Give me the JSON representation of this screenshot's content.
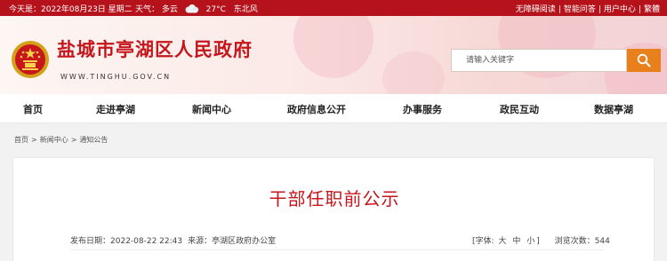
{
  "topbar": {
    "date": "今天是：2022年08月23日 星期二",
    "weather_label": "天气：",
    "condition": "多云",
    "temperature": "27°C",
    "wind": "东北风",
    "links": [
      "无障碍阅读",
      "智能问答",
      "用户中心",
      "繁體"
    ],
    "separator": "|"
  },
  "header": {
    "site_title": "盐城市亭湖区人民政府",
    "site_url": "WWW.TINGHU.GOV.CN",
    "search_placeholder": "请输入关键字"
  },
  "nav": {
    "items": [
      "首页",
      "走进亭湖",
      "新闻中心",
      "政府信息公开",
      "办事服务",
      "政民互动",
      "数据亭湖"
    ]
  },
  "breadcrumb": {
    "items": [
      "首页",
      "新闻中心",
      "通知公告"
    ],
    "separator": ">"
  },
  "article": {
    "title": "干部任职前公示",
    "publish_label": "发布日期：",
    "publish_time": "2022-08-22 22:43",
    "source_label": "来源：",
    "source": "亭湖区政府办公室",
    "font_label": "[字体:",
    "font_sizes": [
      "大",
      "中",
      "小"
    ],
    "font_close": "]",
    "views_label": "浏览次数：",
    "views": "544"
  },
  "colors": {
    "topbar": "#b5121b",
    "title_red": "#c4161c",
    "search_button": "#e8811c"
  },
  "icons": [
    "cloud-icon",
    "national-emblem-icon",
    "search-icon"
  ]
}
